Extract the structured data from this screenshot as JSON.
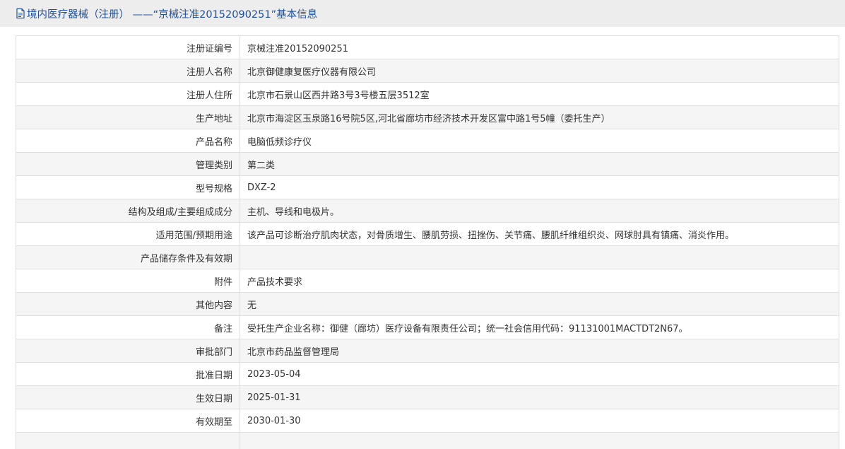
{
  "header": {
    "icon": "document-icon",
    "title": "境内医疗器械（注册） ——“京械注准20152090251”基本信息"
  },
  "rows": [
    {
      "label": "注册证编号",
      "value": "京械注准20152090251"
    },
    {
      "label": "注册人名称",
      "value": "北京御健康复医疗仪器有限公司"
    },
    {
      "label": "注册人住所",
      "value": "北京市石景山区西井路3号3号楼五层3512室"
    },
    {
      "label": "生产地址",
      "value": "北京市海淀区玉泉路16号院5区,河北省廊坊市经济技术开发区富中路1号5幢（委托生产）"
    },
    {
      "label": "产品名称",
      "value": "电脑低频诊疗仪"
    },
    {
      "label": "管理类别",
      "value": "第二类"
    },
    {
      "label": "型号规格",
      "value": "DXZ-2"
    },
    {
      "label": "结构及组成/主要组成成分",
      "value": "主机、导线和电极片。"
    },
    {
      "label": "适用范围/预期用途",
      "value": "该产品可诊断治疗肌肉状态，对骨质增生、腰肌劳损、扭挫伤、关节痛、腰肌纤维组织炎、网球肘具有镇痛、消炎作用。"
    },
    {
      "label": "产品储存条件及有效期",
      "value": ""
    },
    {
      "label": "附件",
      "value": "产品技术要求"
    },
    {
      "label": "其他内容",
      "value": "无"
    },
    {
      "label": "备注",
      "value": "受托生产企业名称：御健（廊坊）医疗设备有限责任公司；统一社会信用代码：91131001MACTDT2N67。"
    },
    {
      "label": "审批部门",
      "value": "北京市药品监督管理局"
    },
    {
      "label": "批准日期",
      "value": "2023-05-04"
    },
    {
      "label": "生效日期",
      "value": "2025-01-31"
    },
    {
      "label": "有效期至",
      "value": "2030-01-30"
    },
    {
      "label": "",
      "value": ""
    }
  ],
  "colors": {
    "title_text": "#1f4f9a",
    "title_bar": "#ededed",
    "row_alt": "#f5f5f5",
    "border": "#dedede",
    "text": "#333333"
  }
}
